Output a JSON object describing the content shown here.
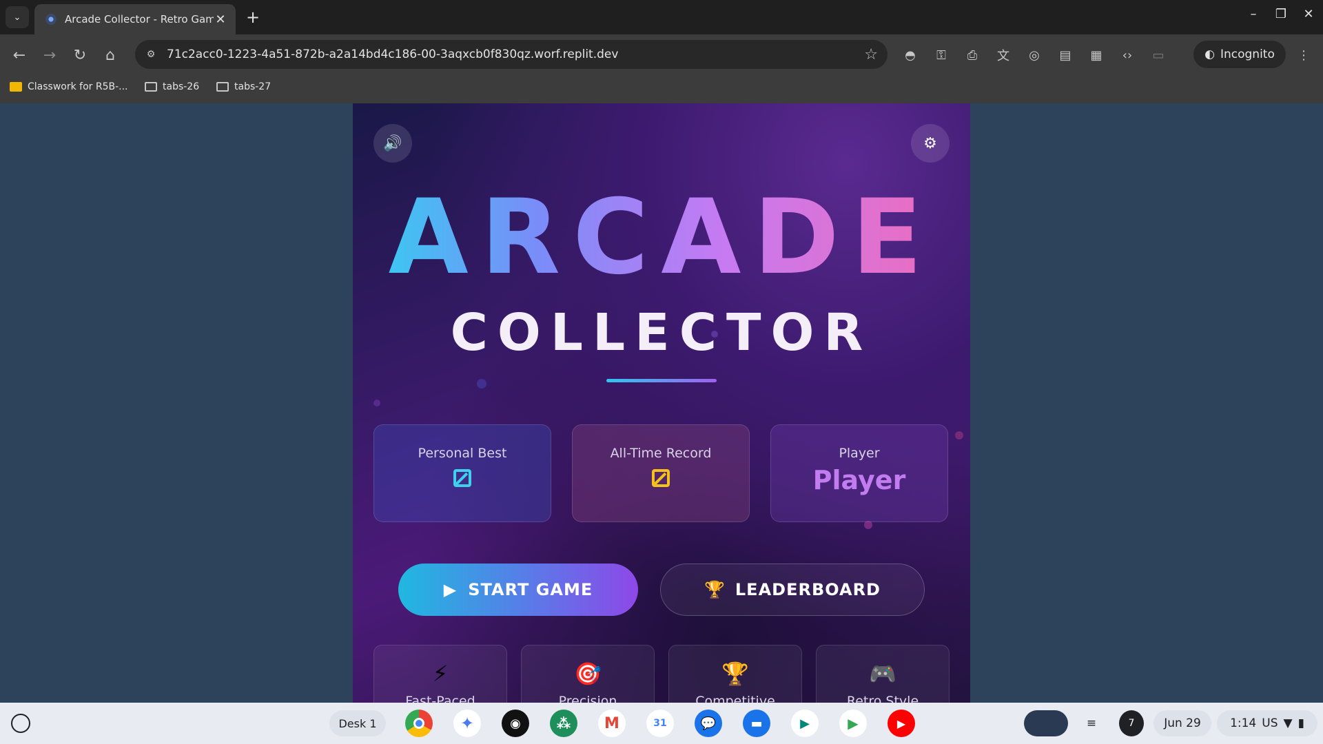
{
  "browser": {
    "tab_title": "Arcade Collector - Retro Game",
    "url": "71c2acc0-1223-4a51-872b-a2a14bd4c186-00-3aqxcb0f830qz.worf.replit.dev",
    "incognito_label": "Incognito",
    "bookmarks": [
      "Classwork for R5B-...",
      "tabs-26",
      "tabs-27"
    ]
  },
  "game": {
    "title_main": "ARCADE",
    "title_sub": "COLLECTOR",
    "stats": [
      {
        "label": "Personal Best",
        "value": "0",
        "color": "#3fd0ee"
      },
      {
        "label": "All-Time Record",
        "value": "0",
        "color": "#f4c21a"
      },
      {
        "label": "Player",
        "value": "Player",
        "color": "#c27cf0"
      }
    ],
    "start_label": "START GAME",
    "leaderboard_label": "LEADERBOARD",
    "features": [
      {
        "icon": "⚡",
        "label": "Fast-Paced"
      },
      {
        "icon": "🎯",
        "label": "Precision"
      },
      {
        "icon": "🏆",
        "label": "Competitive"
      },
      {
        "icon": "🎮",
        "label": "Retro Style"
      }
    ]
  },
  "shelf": {
    "desk_label": "Desk 1",
    "notification_count": "7",
    "date": "Jun 29",
    "time": "1:14",
    "locale": "US"
  }
}
